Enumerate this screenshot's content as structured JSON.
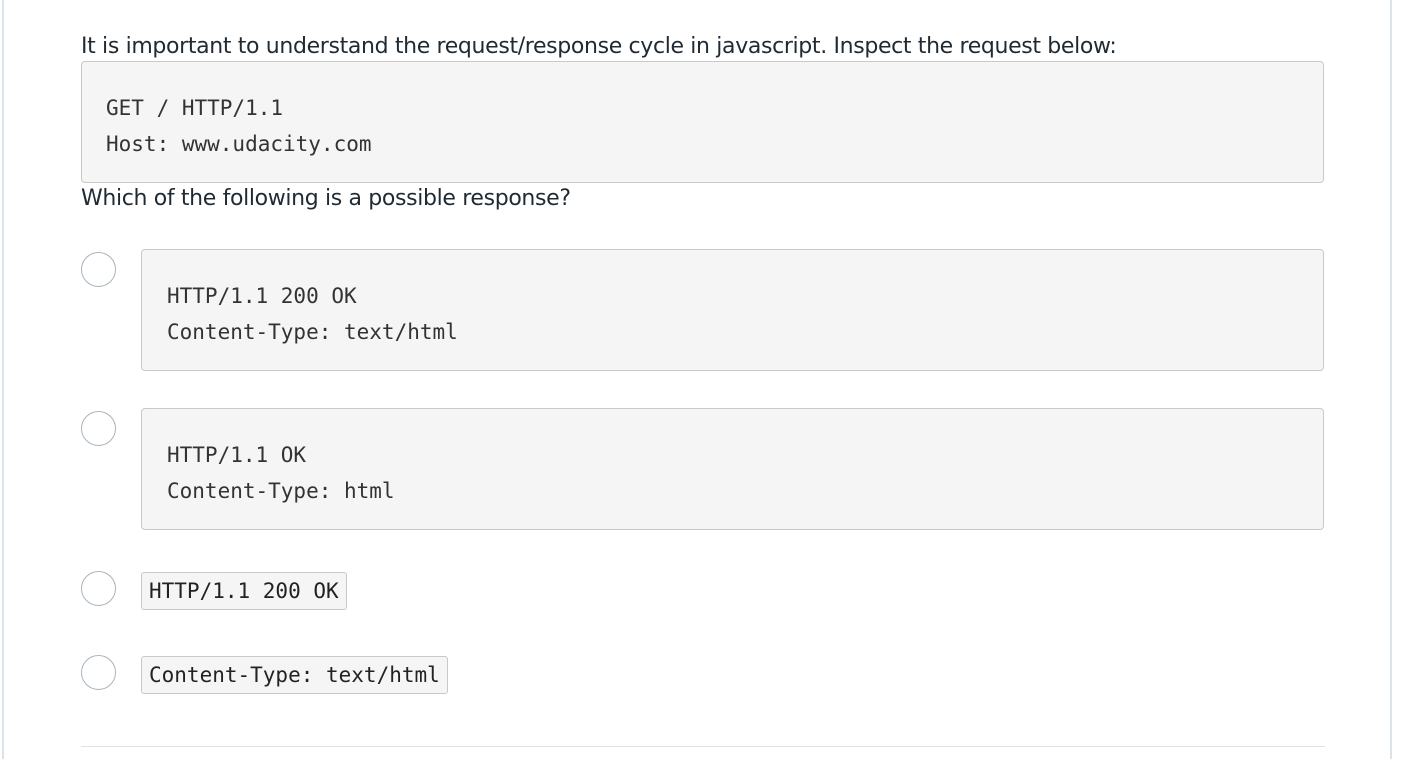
{
  "prompt": "It is important to understand the request/response cycle in javascript. Inspect the request below:",
  "request_code": {
    "lines": [
      "GET / HTTP/1.1",
      "Host: www.udacity.com"
    ]
  },
  "question": "Which of the following is a possible response?",
  "options": [
    {
      "type": "block",
      "selected": false,
      "lines": [
        "HTTP/1.1 200 OK",
        "Content-Type: text/html"
      ]
    },
    {
      "type": "block",
      "selected": false,
      "lines": [
        "HTTP/1.1 OK",
        "Content-Type: html"
      ]
    },
    {
      "type": "inline",
      "selected": false,
      "text": "HTTP/1.1 200 OK"
    },
    {
      "type": "inline",
      "selected": false,
      "text": "Content-Type: text/html"
    }
  ],
  "colors": {
    "text": "#1f2a33",
    "code_background": "#f5f5f5",
    "code_border": "#c9c9c9",
    "radio_border": "#a8b4bd"
  }
}
